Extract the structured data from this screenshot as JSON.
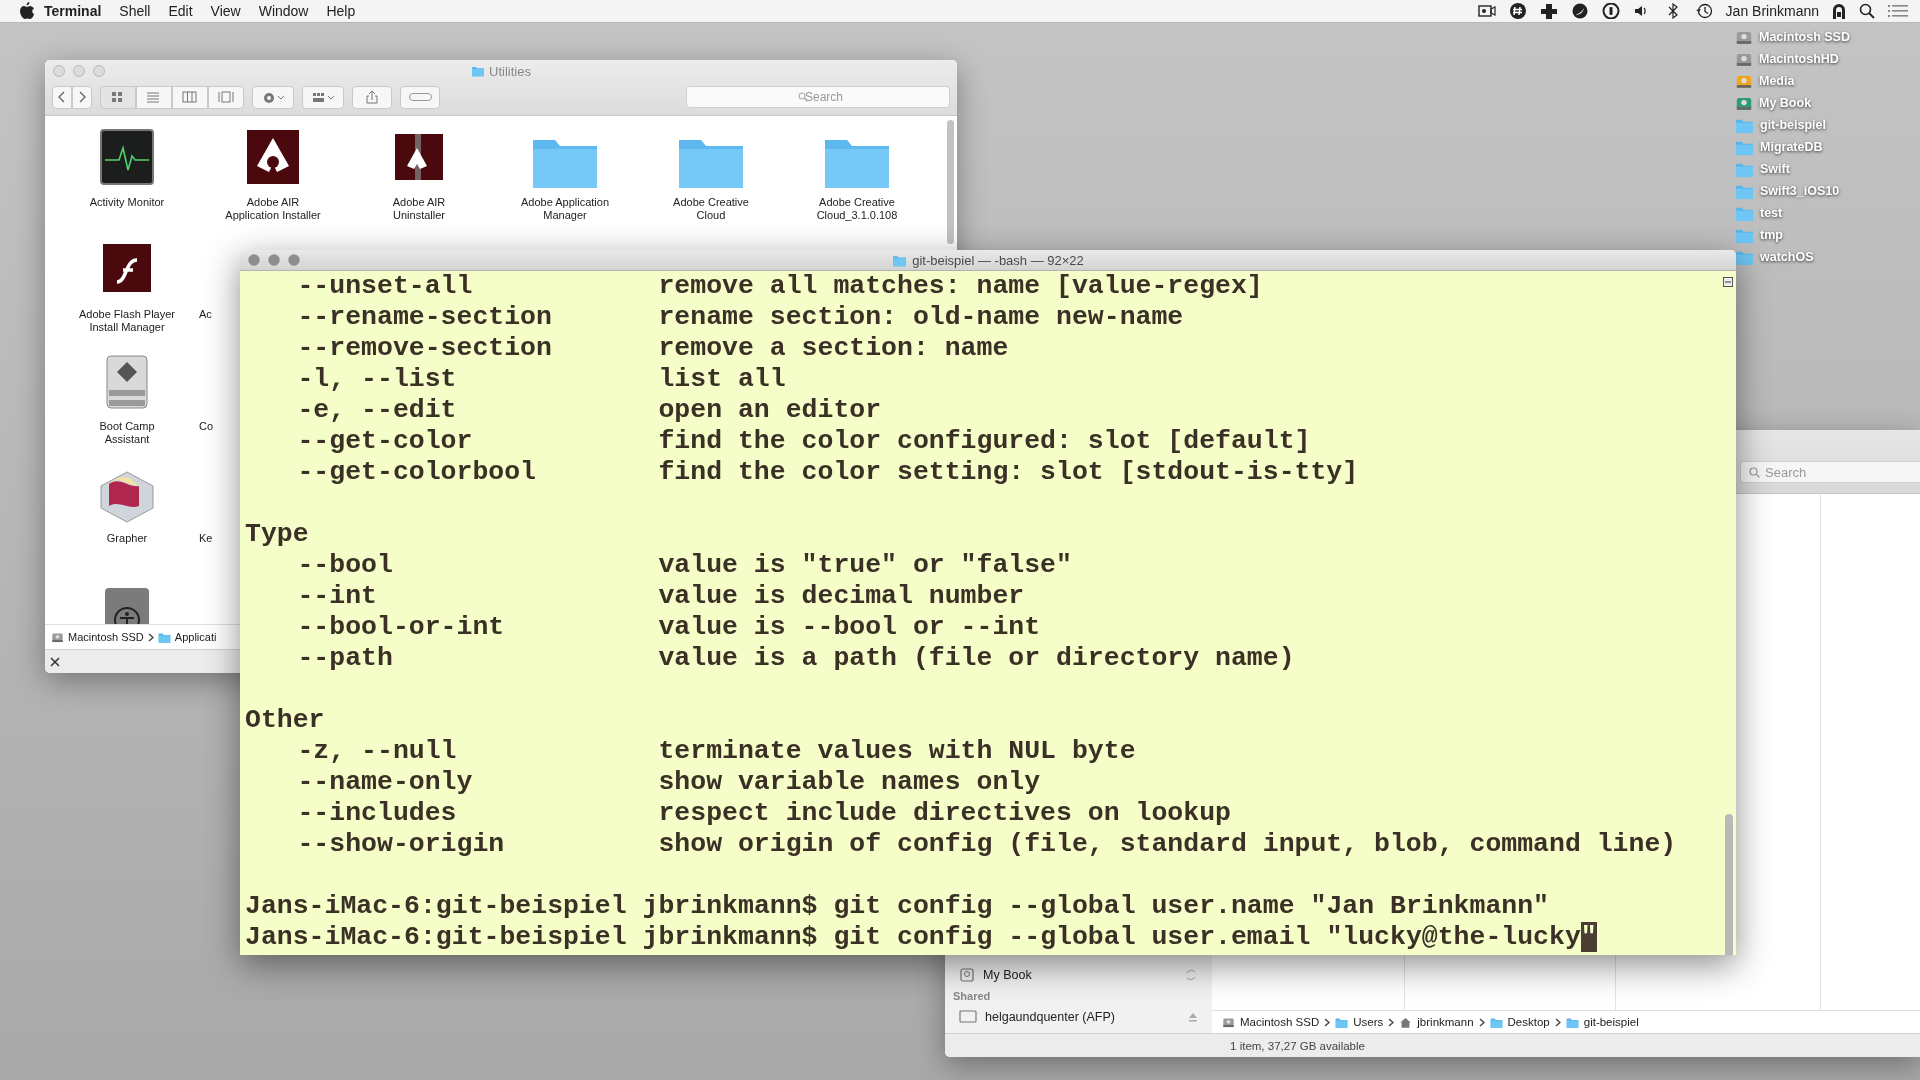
{
  "menubar": {
    "menus": [
      {
        "label": "Terminal",
        "kind": "app"
      },
      {
        "label": "Shell",
        "kind": "menu"
      },
      {
        "label": "Edit",
        "kind": "menu"
      },
      {
        "label": "View",
        "kind": "menu"
      },
      {
        "label": "Window",
        "kind": "menu"
      },
      {
        "label": "Help",
        "kind": "menu"
      }
    ],
    "user": "Jan Brinkmann"
  },
  "desktop_items": [
    {
      "label": "Macintosh SSD",
      "kind": "drive"
    },
    {
      "label": "MacintoshHD",
      "kind": "drive"
    },
    {
      "label": "Media",
      "kind": "external"
    },
    {
      "label": "My Book",
      "kind": "backup"
    },
    {
      "label": "git-beispiel",
      "kind": "folder"
    },
    {
      "label": "MigrateDB",
      "kind": "folder"
    },
    {
      "label": "Swift",
      "kind": "folder"
    },
    {
      "label": "Swift3_iOS10",
      "kind": "folder"
    },
    {
      "label": "test",
      "kind": "folder"
    },
    {
      "label": "tmp",
      "kind": "folder"
    },
    {
      "label": "watchOS",
      "kind": "folder"
    }
  ],
  "finder_window": {
    "title": "Utilities",
    "search": {
      "placeholder": "Search"
    },
    "items": [
      {
        "label": "Activity Monitor",
        "kind": "activity"
      },
      {
        "label": "Adobe AIR\nApplication Installer",
        "kind": "air"
      },
      {
        "label": "Adobe AIR\nUninstaller",
        "kind": "air-box"
      },
      {
        "label": "Adobe Application\nManager",
        "kind": "folder"
      },
      {
        "label": "Adobe Creative\nCloud",
        "kind": "folder"
      },
      {
        "label": "Adobe Creative\nCloud_3.1.0.108",
        "kind": "folder"
      },
      {
        "label": "Adobe Flash Player\nInstall Manager",
        "kind": "flash"
      },
      {
        "label": "Boot Camp\nAssistant",
        "kind": "bootcamp"
      },
      {
        "label": "Grapher",
        "kind": "grapher"
      },
      {
        "kind": "accessibility"
      }
    ],
    "partial_labels": [
      "Ac",
      "Co",
      "Ke"
    ],
    "path": [
      {
        "label": "Macintosh SSD",
        "kind": "drive"
      },
      {
        "label": "Applicati",
        "kind": "folder"
      }
    ]
  },
  "terminal": {
    "title": "git-beispiel — -bash — 92×22",
    "lines": [
      {
        "kind": "option",
        "option": "--unset-all",
        "text": "remove all matches: name [value-regex]"
      },
      {
        "kind": "option",
        "option": "--rename-section",
        "text": "rename section: old-name new-name"
      },
      {
        "kind": "option",
        "option": "--remove-section",
        "text": "remove a section: name"
      },
      {
        "kind": "option",
        "option": "-l, --list",
        "text": "list all"
      },
      {
        "kind": "option",
        "option": "-e, --edit",
        "text": "open an editor"
      },
      {
        "kind": "option",
        "option": "--get-color",
        "text": "find the color configured: slot [default]"
      },
      {
        "kind": "option",
        "option": "--get-colorbool",
        "text": "find the color setting: slot [stdout-is-tty]"
      },
      {
        "kind": "blank"
      },
      {
        "kind": "heading",
        "text": "Type"
      },
      {
        "kind": "option",
        "option": "--bool",
        "text": "value is \"true\" or \"false\""
      },
      {
        "kind": "option",
        "option": "--int",
        "text": "value is decimal number"
      },
      {
        "kind": "option",
        "option": "--bool-or-int",
        "text": "value is --bool or --int"
      },
      {
        "kind": "option",
        "option": "--path",
        "text": "value is a path (file or directory name)"
      },
      {
        "kind": "blank"
      },
      {
        "kind": "heading",
        "text": "Other"
      },
      {
        "kind": "option",
        "option": "-z, --null",
        "text": "terminate values with NUL byte"
      },
      {
        "kind": "option",
        "option": "--name-only",
        "text": "show variable names only"
      },
      {
        "kind": "option",
        "option": "--includes",
        "text": "respect include directives on lookup"
      },
      {
        "kind": "option",
        "option": "--show-origin",
        "text": "show origin of config (file, standard input, blob, command line)"
      },
      {
        "kind": "blank"
      },
      {
        "kind": "prompt",
        "text": "Jans-iMac-6:git-beispiel jbrinkmann$ git config --global user.name \"Jan Brinkmann\"",
        "cursor": false
      },
      {
        "kind": "prompt",
        "text": "Jans-iMac-6:git-beispiel jbrinkmann$ git config --global user.email \"lucky@the-lucky\"",
        "cursor": true
      }
    ]
  },
  "finder_window_2": {
    "search": {
      "placeholder": "Search"
    },
    "sidebar": [
      {
        "label": "My Book",
        "kind": "drive"
      },
      {
        "label": "Shared",
        "kind": "header"
      },
      {
        "label": "helgaundquenter (AFP)",
        "kind": "server"
      }
    ],
    "path": [
      {
        "label": "Macintosh SSD",
        "kind": "drive"
      },
      {
        "label": "Users",
        "kind": "folder"
      },
      {
        "label": "jbrinkmann",
        "kind": "home"
      },
      {
        "label": "Desktop",
        "kind": "folder"
      },
      {
        "label": "git-beispiel",
        "kind": "folder"
      }
    ],
    "status": "1 item, 37,27 GB available"
  }
}
